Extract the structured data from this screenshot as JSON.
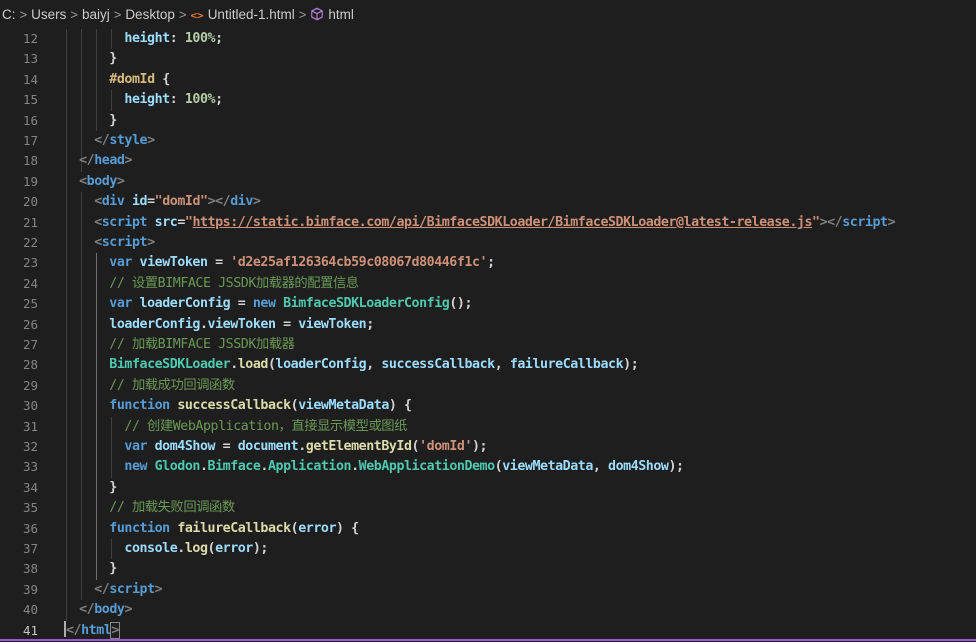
{
  "breadcrumb": {
    "items": [
      "C:",
      "Users",
      "baiyj",
      "Desktop",
      "Untitled-1.html",
      "html"
    ],
    "separator": ">"
  },
  "editor": {
    "current_line": 41,
    "lines": [
      {
        "n": "12",
        "tokens": [
          [
            "t-prop",
            "height"
          ],
          [
            "t-text",
            ": "
          ],
          [
            "t-num",
            "100%"
          ],
          [
            "t-text",
            ";"
          ]
        ]
      },
      {
        "n": "13",
        "tokens": [
          [
            "t-text",
            "}"
          ]
        ]
      },
      {
        "n": "14",
        "tokens": [
          [
            "t-sel",
            "#domId"
          ],
          [
            "t-text",
            " {"
          ]
        ]
      },
      {
        "n": "15",
        "tokens": [
          [
            "t-prop",
            "height"
          ],
          [
            "t-text",
            ": "
          ],
          [
            "t-num",
            "100%"
          ],
          [
            "t-text",
            ";"
          ]
        ]
      },
      {
        "n": "16",
        "tokens": [
          [
            "t-text",
            "}"
          ]
        ]
      },
      {
        "n": "17",
        "tokens": [
          [
            "t-punc",
            "</"
          ],
          [
            "t-tag",
            "style"
          ],
          [
            "t-punc",
            ">"
          ]
        ]
      },
      {
        "n": "18",
        "tokens": [
          [
            "t-punc",
            "</"
          ],
          [
            "t-tag",
            "head"
          ],
          [
            "t-punc",
            ">"
          ]
        ]
      },
      {
        "n": "19",
        "tokens": [
          [
            "t-punc",
            "<"
          ],
          [
            "t-tag",
            "body"
          ],
          [
            "t-punc",
            ">"
          ]
        ]
      },
      {
        "n": "20",
        "tokens": [
          [
            "t-punc",
            "<"
          ],
          [
            "t-tag",
            "div"
          ],
          [
            "t-text",
            " "
          ],
          [
            "t-attr",
            "id"
          ],
          [
            "t-text",
            "="
          ],
          [
            "t-str",
            "\"domId\""
          ],
          [
            "t-punc",
            "></"
          ],
          [
            "t-tag",
            "div"
          ],
          [
            "t-punc",
            ">"
          ]
        ]
      },
      {
        "n": "21",
        "tokens": [
          [
            "t-punc",
            "<"
          ],
          [
            "t-tag",
            "script"
          ],
          [
            "t-text",
            " "
          ],
          [
            "t-attr",
            "src"
          ],
          [
            "t-text",
            "="
          ],
          [
            "t-str",
            "\""
          ],
          [
            "t-link",
            "https://static.bimface.com/api/BimfaceSDKLoader/BimfaceSDKLoader@latest-release.js"
          ],
          [
            "t-str",
            "\""
          ],
          [
            "t-punc",
            "></"
          ],
          [
            "t-tag",
            "script"
          ],
          [
            "t-punc",
            ">"
          ]
        ]
      },
      {
        "n": "22",
        "tokens": [
          [
            "t-punc",
            "<"
          ],
          [
            "t-tag",
            "script"
          ],
          [
            "t-punc",
            ">"
          ]
        ]
      },
      {
        "n": "23",
        "tokens": [
          [
            "t-kw",
            "var"
          ],
          [
            "t-text",
            " "
          ],
          [
            "t-var",
            "viewToken"
          ],
          [
            "t-text",
            " = "
          ],
          [
            "t-str",
            "'d2e25af126364cb59c08067d80446f1c'"
          ],
          [
            "t-text",
            ";"
          ]
        ]
      },
      {
        "n": "24",
        "tokens": [
          [
            "t-com",
            "// 设置BIMFACE JSSDK加载器的配置信息"
          ]
        ]
      },
      {
        "n": "25",
        "tokens": [
          [
            "t-kw",
            "var"
          ],
          [
            "t-text",
            " "
          ],
          [
            "t-var",
            "loaderConfig"
          ],
          [
            "t-text",
            " = "
          ],
          [
            "t-kw",
            "new"
          ],
          [
            "t-text",
            " "
          ],
          [
            "t-cls",
            "BimfaceSDKLoaderConfig"
          ],
          [
            "t-text",
            "();"
          ]
        ]
      },
      {
        "n": "26",
        "tokens": [
          [
            "t-var",
            "loaderConfig"
          ],
          [
            "t-text",
            "."
          ],
          [
            "t-var",
            "viewToken"
          ],
          [
            "t-text",
            " = "
          ],
          [
            "t-var",
            "viewToken"
          ],
          [
            "t-text",
            ";"
          ]
        ]
      },
      {
        "n": "27",
        "tokens": [
          [
            "t-com",
            "// 加载BIMFACE JSSDK加载器"
          ]
        ]
      },
      {
        "n": "28",
        "tokens": [
          [
            "t-cls",
            "BimfaceSDKLoader"
          ],
          [
            "t-text",
            "."
          ],
          [
            "t-fn",
            "load"
          ],
          [
            "t-text",
            "("
          ],
          [
            "t-var",
            "loaderConfig"
          ],
          [
            "t-text",
            ", "
          ],
          [
            "t-var",
            "successCallback"
          ],
          [
            "t-text",
            ", "
          ],
          [
            "t-var",
            "failureCallback"
          ],
          [
            "t-text",
            ");"
          ]
        ]
      },
      {
        "n": "29",
        "tokens": [
          [
            "t-com",
            "// 加载成功回调函数"
          ]
        ]
      },
      {
        "n": "30",
        "tokens": [
          [
            "t-kw",
            "function"
          ],
          [
            "t-text",
            " "
          ],
          [
            "t-fn",
            "successCallback"
          ],
          [
            "t-text",
            "("
          ],
          [
            "t-var",
            "viewMetaData"
          ],
          [
            "t-text",
            ") {"
          ]
        ]
      },
      {
        "n": "31",
        "tokens": [
          [
            "t-com",
            "// 创建WebApplication，直接显示模型或图纸"
          ]
        ]
      },
      {
        "n": "32",
        "tokens": [
          [
            "t-kw",
            "var"
          ],
          [
            "t-text",
            " "
          ],
          [
            "t-var",
            "dom4Show"
          ],
          [
            "t-text",
            " = "
          ],
          [
            "t-var",
            "document"
          ],
          [
            "t-text",
            "."
          ],
          [
            "t-fn",
            "getElementById"
          ],
          [
            "t-text",
            "("
          ],
          [
            "t-str",
            "'domId'"
          ],
          [
            "t-text",
            ");"
          ]
        ]
      },
      {
        "n": "33",
        "tokens": [
          [
            "t-kw",
            "new"
          ],
          [
            "t-text",
            " "
          ],
          [
            "t-cls",
            "Glodon"
          ],
          [
            "t-text",
            "."
          ],
          [
            "t-cls",
            "Bimface"
          ],
          [
            "t-text",
            "."
          ],
          [
            "t-cls",
            "Application"
          ],
          [
            "t-text",
            "."
          ],
          [
            "t-cls",
            "WebApplicationDemo"
          ],
          [
            "t-text",
            "("
          ],
          [
            "t-var",
            "viewMetaData"
          ],
          [
            "t-text",
            ", "
          ],
          [
            "t-var",
            "dom4Show"
          ],
          [
            "t-text",
            ");"
          ]
        ]
      },
      {
        "n": "34",
        "tokens": [
          [
            "t-text",
            "}"
          ]
        ]
      },
      {
        "n": "35",
        "tokens": [
          [
            "t-com",
            "// 加载失败回调函数"
          ]
        ]
      },
      {
        "n": "36",
        "tokens": [
          [
            "t-kw",
            "function"
          ],
          [
            "t-text",
            " "
          ],
          [
            "t-fn",
            "failureCallback"
          ],
          [
            "t-text",
            "("
          ],
          [
            "t-var",
            "error"
          ],
          [
            "t-text",
            ") {"
          ]
        ]
      },
      {
        "n": "37",
        "tokens": [
          [
            "t-var",
            "console"
          ],
          [
            "t-text",
            "."
          ],
          [
            "t-fn",
            "log"
          ],
          [
            "t-text",
            "("
          ],
          [
            "t-var",
            "error"
          ],
          [
            "t-text",
            ");"
          ]
        ]
      },
      {
        "n": "38",
        "tokens": [
          [
            "t-text",
            "}"
          ]
        ]
      },
      {
        "n": "39",
        "tokens": [
          [
            "t-punc",
            "</"
          ],
          [
            "t-tag",
            "script"
          ],
          [
            "t-punc",
            ">"
          ]
        ]
      },
      {
        "n": "40",
        "tokens": [
          [
            "t-punc",
            "</"
          ],
          [
            "t-tag",
            "body"
          ],
          [
            "t-punc",
            ">"
          ]
        ]
      },
      {
        "n": "41",
        "tokens": [
          [
            "t-punc",
            "</"
          ],
          [
            "t-tag",
            "html"
          ],
          [
            "t-punc",
            ">"
          ]
        ]
      }
    ]
  },
  "colors": {
    "background": "#1e1e1e",
    "line_number": "#858585",
    "tag": "#569cd6",
    "string": "#ce9178",
    "attribute": "#9cdcfe",
    "comment": "#6a9955",
    "function": "#dcdcaa",
    "class": "#4ec9b0",
    "number": "#b5cea8",
    "selector": "#d7ba7d",
    "current_line_border": "#9a58d6"
  }
}
